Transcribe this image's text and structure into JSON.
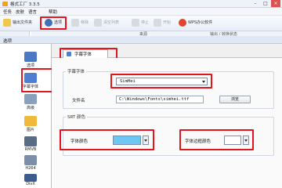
{
  "window": {
    "title": "格式工厂 3.3.5",
    "minimize": "–",
    "maximize": "□",
    "close": "×"
  },
  "menu": [
    "任务",
    "皮肤",
    "语言",
    "帮助"
  ],
  "toolbar": {
    "output_folder": "输出文件夹",
    "options": "选项",
    "remove": "移除",
    "clear_list": "清空列表",
    "stop": "停止",
    "start": "开始",
    "wps": "WPS办公软件"
  },
  "list_header": [
    "来源",
    "输出 / 转换状态"
  ],
  "dialog": {
    "title": "选项",
    "nav": [
      {
        "label": "选项",
        "icon": "options-icon"
      },
      {
        "label": "字幕字体",
        "icon": "subtitle-font-icon"
      },
      {
        "label": "高级",
        "icon": "advanced-icon"
      },
      {
        "label": "图片",
        "icon": "picture-icon"
      },
      {
        "label": "RMVB",
        "icon": "rmvb-icon"
      },
      {
        "label": "H264",
        "icon": "h264-icon"
      },
      {
        "label": "DivX",
        "icon": "divx-icon"
      }
    ],
    "tab": "字幕字体",
    "font_group": "字幕字体",
    "font_value": "SimHei",
    "file_label": "文件名",
    "file_value": "C:\\Windows\\Fonts\\simhei.ttf",
    "browse": "浏览",
    "color_group": "SRT 颜色",
    "font_color_label": "字体颜色",
    "font_color": "#6ec6f5",
    "border_color_label": "字体边框颜色",
    "border_color": "#ffffff"
  },
  "colors": {
    "highlight": "#e2141e",
    "accent": "#4f7fd0"
  }
}
